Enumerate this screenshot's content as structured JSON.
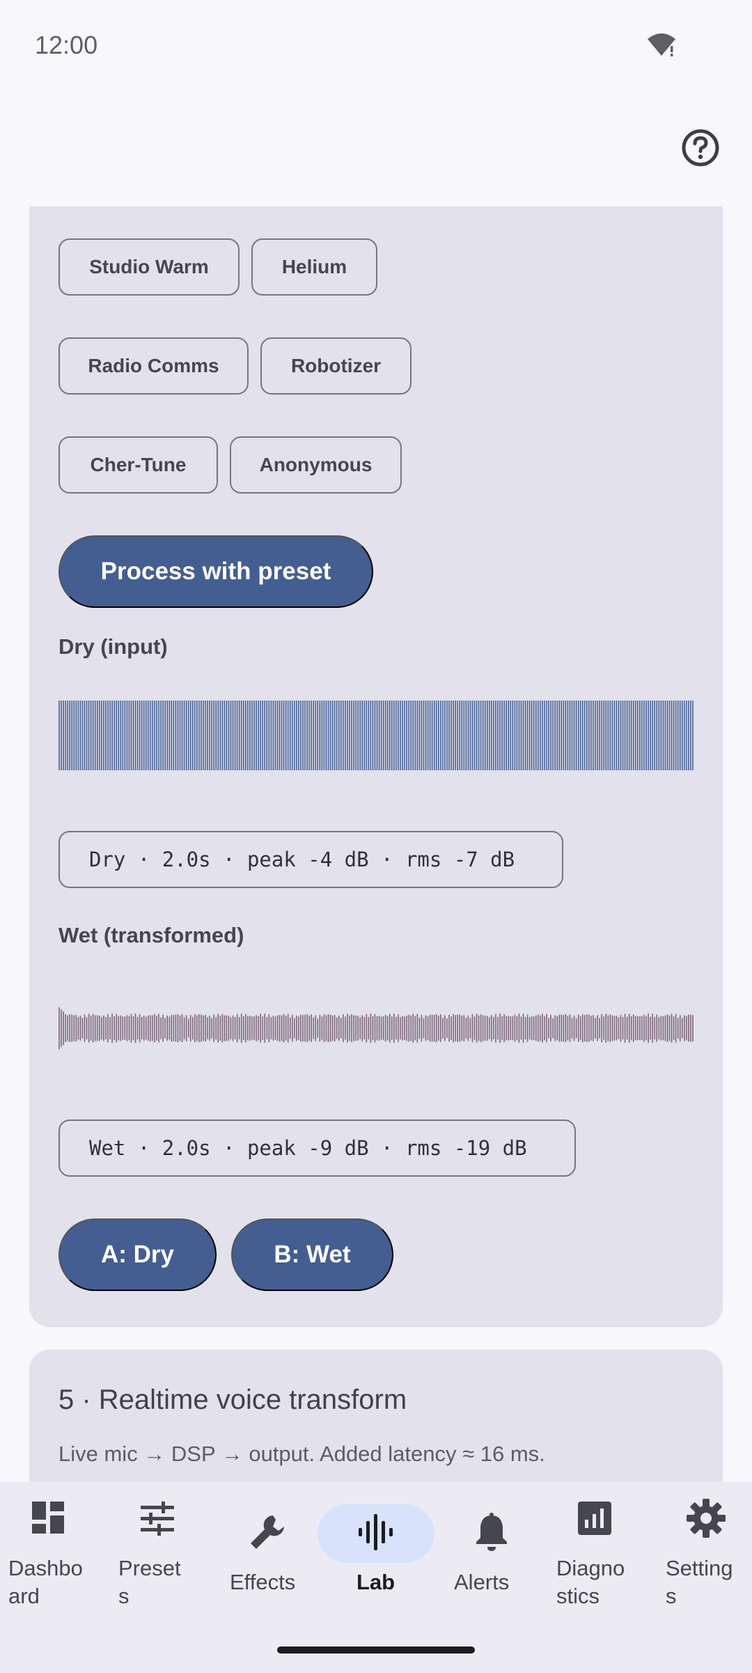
{
  "status": {
    "time": "12:00"
  },
  "presets": [
    {
      "label": "Studio Warm"
    },
    {
      "label": "Helium"
    },
    {
      "label": "Radio Comms"
    },
    {
      "label": "Robotizer"
    },
    {
      "label": "Cher-Tune"
    },
    {
      "label": "Anonymous"
    }
  ],
  "process_button": "Process with preset",
  "dry": {
    "label": "Dry (input)",
    "readout": "Dry · 2.0s · peak -4 dB · rms -7 dB",
    "color": "#445e91"
  },
  "wet": {
    "label": "Wet (transformed)",
    "readout": "Wet · 2.0s · peak -9 dB · rms -19 dB",
    "color": "#7b6479"
  },
  "ab": {
    "a_label": "A: Dry",
    "b_label": "B: Wet"
  },
  "realtime": {
    "title": "5 · Realtime voice transform",
    "subtitle": "Live mic → DSP → output. Added latency ≈ 16 ms."
  },
  "nav": [
    {
      "label": "Dashbo\nard",
      "icon": "dashboard-icon"
    },
    {
      "label": "Preset\ns",
      "icon": "tune-icon"
    },
    {
      "label": "Effects",
      "icon": "wrench-icon"
    },
    {
      "label": "Lab",
      "icon": "waveform-icon",
      "selected": true
    },
    {
      "label": "Alerts",
      "icon": "bell-icon"
    },
    {
      "label": "Diagno\nstics",
      "icon": "chart-icon"
    },
    {
      "label": "Setting\ns",
      "icon": "gear-icon"
    }
  ],
  "colors": {
    "primary": "#445e91",
    "card": "#e2e1ec",
    "nav_selected": "#d8e2fb"
  }
}
